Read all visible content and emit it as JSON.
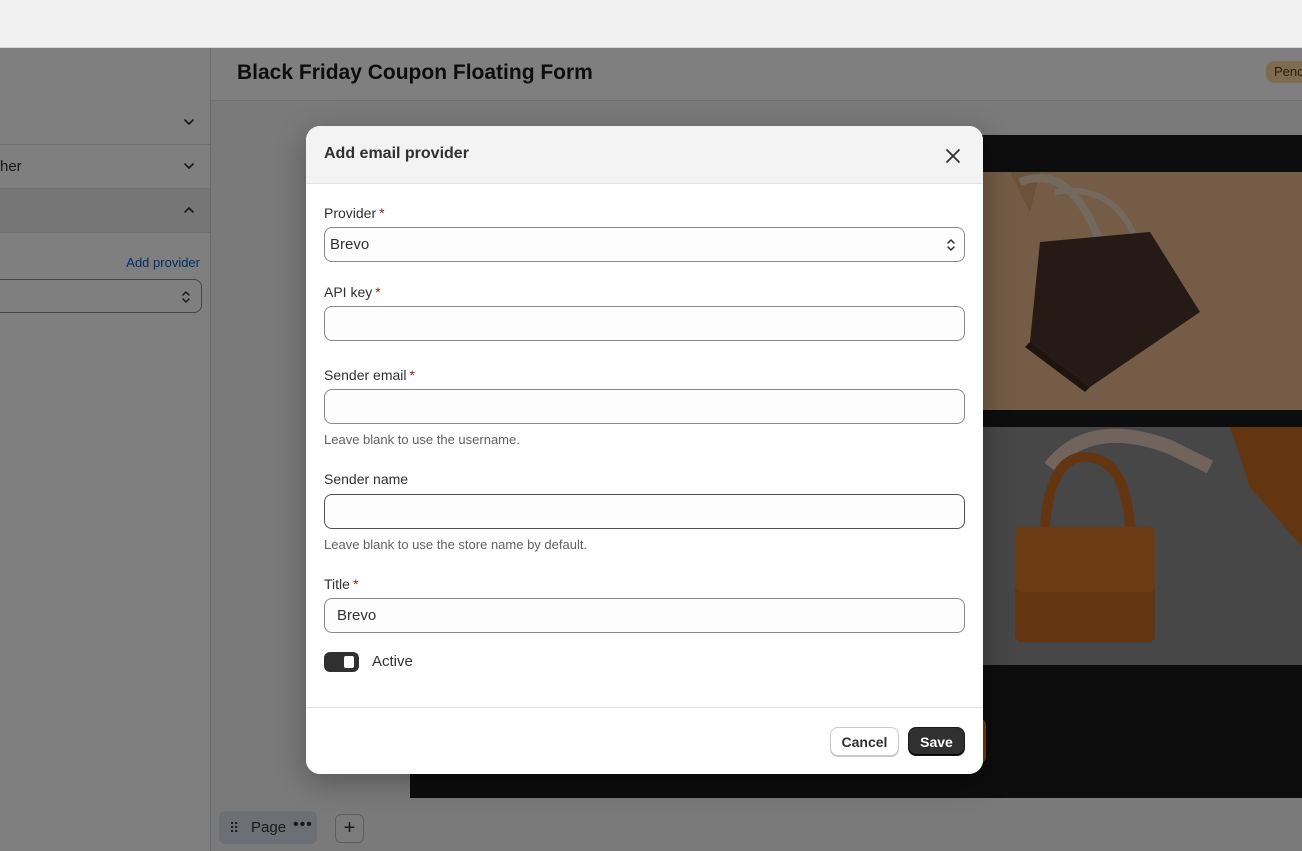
{
  "sidebar": {
    "rows": [
      {
        "label": ""
      },
      {
        "label": "her"
      },
      {
        "label": ""
      }
    ],
    "add_provider_link": "Add provider"
  },
  "main": {
    "title": "Black Friday Coupon Floating Form",
    "status_badge": "Pend",
    "bottom_bar": {
      "page_tab_label": "Page",
      "more_label": "•••",
      "add_label": "+"
    }
  },
  "modal": {
    "title": "Add email provider",
    "provider": {
      "label": "Provider",
      "required": "*",
      "value": "Brevo"
    },
    "api_key": {
      "label": "API key",
      "required": "*",
      "value": ""
    },
    "sender_email": {
      "label": "Sender email",
      "required": "*",
      "value": "",
      "help": "Leave blank to use the username."
    },
    "sender_name": {
      "label": "Sender name",
      "value": "",
      "help": "Leave blank to use the store name by default."
    },
    "title_field": {
      "label": "Title",
      "required": "*",
      "value": "Brevo"
    },
    "active_toggle": {
      "label": "Active",
      "on": true
    },
    "cancel_label": "Cancel",
    "save_label": "Save"
  },
  "colors": {
    "primary_button": "#303030",
    "required_asterisk": "#8e1f0b",
    "link": "#005bd3",
    "badge_bg": "#ffd6a4"
  },
  "icons": [
    "chevron-down-icon",
    "chevron-up-icon",
    "select-updown-icon",
    "close-icon",
    "drag-handle-icon",
    "more-icon",
    "plus-icon"
  ]
}
